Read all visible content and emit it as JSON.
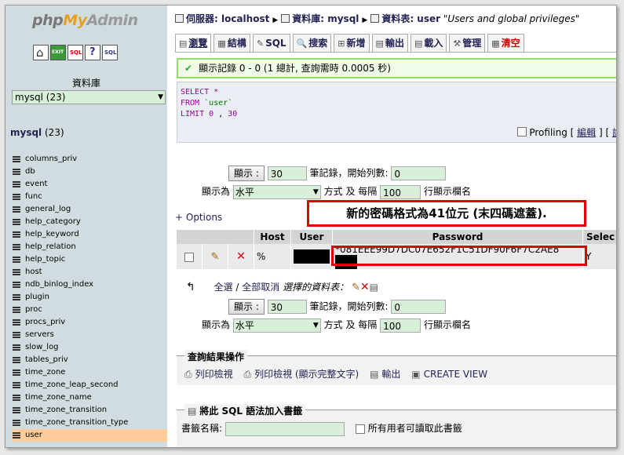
{
  "nav": {
    "logo": {
      "php": "php",
      "my": "My",
      "admin": "Admin"
    },
    "db_label": "資料庫",
    "db_select": "mysql (23)",
    "current_db": "mysql",
    "current_db_count": "(23)",
    "tables": [
      "columns_priv",
      "db",
      "event",
      "func",
      "general_log",
      "help_category",
      "help_keyword",
      "help_relation",
      "help_topic",
      "host",
      "ndb_binlog_index",
      "plugin",
      "proc",
      "procs_priv",
      "servers",
      "slow_log",
      "tables_priv",
      "time_zone",
      "time_zone_leap_second",
      "time_zone_name",
      "time_zone_transition",
      "time_zone_transition_type",
      "user"
    ]
  },
  "breadcrumb": {
    "server": "伺服器: localhost",
    "database": "資料庫: mysql",
    "table": "資料表: user",
    "comment": "\"Users and global privileges\""
  },
  "tabs": [
    "瀏覽",
    "結構",
    "SQL",
    "搜索",
    "新增",
    "輸出",
    "載入",
    "管理",
    "清空"
  ],
  "notice": "顯示記錄 0 - 0 (1 總計, 查詢需時 0.0005 秒)",
  "sql": {
    "select": "SELECT",
    "star": "*",
    "from": "FROM",
    "table": "`user`",
    "limit": "LIMIT",
    "offset": "0",
    "comma": ",",
    "count": "30"
  },
  "profiling": {
    "label": "Profiling",
    "edit": "編輯",
    "explain": "說"
  },
  "navigator": {
    "show_button": "顯示 :",
    "rows": "30",
    "rows_label": "筆記錄，開始列數:",
    "start": "0",
    "mode_label": "顯示為",
    "mode": "水平",
    "mode_suffix": "方式 及 每隔",
    "repeat": "100",
    "repeat_suffix": "行顯示欄名"
  },
  "options_link": "+ Options",
  "callout": "新的密碼格式為41位元 (末四碼遮蓋).",
  "result": {
    "headers": [
      "Host",
      "User",
      "Password",
      "Selec"
    ],
    "row": {
      "host": "%",
      "password": "*081EEE99D7DC07E652F1C51DF90F6F7C2AE8",
      "select": "Y"
    }
  },
  "selection": {
    "check_all": "全選",
    "slash": " / ",
    "uncheck_all": "全部取消",
    "selected": "選擇的資料表："
  },
  "ops": {
    "legend": "查詢結果操作",
    "print": "列印檢視",
    "print_full": "列印檢視 (顯示完整文字)",
    "export": "輸出",
    "create_view": "CREATE VIEW"
  },
  "bookmark": {
    "legend": "將此 SQL 語法加入書籤",
    "label": "書籤名稱:",
    "public": "所有用者可讀取此書籤"
  }
}
